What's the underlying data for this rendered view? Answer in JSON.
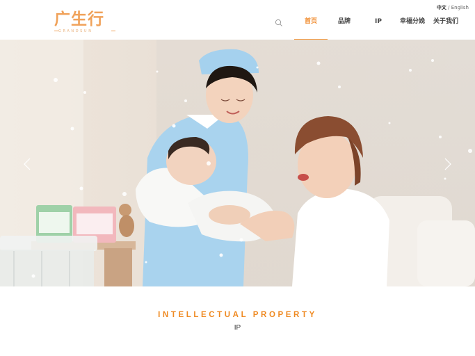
{
  "header": {
    "logo_text": "广生行",
    "logo_sub": "GRANDSUN",
    "lang_current": "中文",
    "lang_separator": " / ",
    "lang_other": "English",
    "nav": [
      {
        "label": "首页",
        "active": true
      },
      {
        "label": "品牌",
        "active": false
      },
      {
        "label": "IP",
        "active": false
      },
      {
        "label": "幸福分娩",
        "active": false
      },
      {
        "label": "关于我们",
        "active": false
      }
    ],
    "search_icon": "search-icon"
  },
  "hero": {
    "prev_icon": "chevron-left-icon",
    "next_icon": "chevron-right-icon",
    "accent_color": "#f39a43"
  },
  "section": {
    "title": "INTELLECTUAL PROPERTY",
    "subtitle": "IP"
  }
}
